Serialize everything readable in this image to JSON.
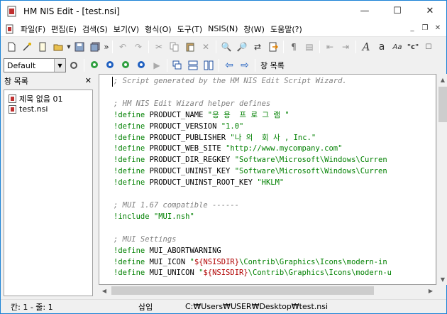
{
  "window": {
    "title": "HM NIS Edit - [test.nsi]",
    "minimize": "—",
    "maximize": "☐",
    "close": "✕"
  },
  "menu": {
    "items": [
      "파일(F)",
      "편집(E)",
      "검색(S)",
      "보기(V)",
      "형식(O)",
      "도구(T)",
      "NSIS(N)",
      "창(W)",
      "도움말(?)"
    ],
    "mdi_minimize": "_",
    "mdi_restore": "❐",
    "mdi_close": "✕"
  },
  "toolbar2": {
    "style_value": "Default",
    "window_list_label": "창 목록"
  },
  "panel": {
    "title": "창 목록",
    "close": "✕",
    "items": [
      "제목 없음 01",
      "test.nsi"
    ]
  },
  "editor": {
    "lines": [
      [
        {
          "c": "cm",
          "t": "; Script generated by the HM NIS Edit Script Wizard."
        }
      ],
      [
        {
          "c": "",
          "t": " "
        }
      ],
      [
        {
          "c": "cm",
          "t": "; HM NIS Edit Wizard helper defines"
        }
      ],
      [
        {
          "c": "kw",
          "t": "!define"
        },
        {
          "c": "",
          "t": " PRODUCT_NAME "
        },
        {
          "c": "st",
          "t": "\"응 용  프 로 그 램 \""
        }
      ],
      [
        {
          "c": "kw",
          "t": "!define"
        },
        {
          "c": "",
          "t": " PRODUCT_VERSION "
        },
        {
          "c": "st",
          "t": "\"1.0\""
        }
      ],
      [
        {
          "c": "kw",
          "t": "!define"
        },
        {
          "c": "",
          "t": " PRODUCT_PUBLISHER "
        },
        {
          "c": "st",
          "t": "\"나 의  회 사 , Inc.\""
        }
      ],
      [
        {
          "c": "kw",
          "t": "!define"
        },
        {
          "c": "",
          "t": " PRODUCT_WEB_SITE "
        },
        {
          "c": "st",
          "t": "\"http://www.mycompany.com\""
        }
      ],
      [
        {
          "c": "kw",
          "t": "!define"
        },
        {
          "c": "",
          "t": " PRODUCT_DIR_REGKEY "
        },
        {
          "c": "st",
          "t": "\"Software\\Microsoft\\Windows\\Curren"
        }
      ],
      [
        {
          "c": "kw",
          "t": "!define"
        },
        {
          "c": "",
          "t": " PRODUCT_UNINST_KEY "
        },
        {
          "c": "st",
          "t": "\"Software\\Microsoft\\Windows\\Curren"
        }
      ],
      [
        {
          "c": "kw",
          "t": "!define"
        },
        {
          "c": "",
          "t": " PRODUCT_UNINST_ROOT_KEY "
        },
        {
          "c": "st",
          "t": "\"HKLM\""
        }
      ],
      [
        {
          "c": "",
          "t": " "
        }
      ],
      [
        {
          "c": "cm",
          "t": "; MUI 1.67 compatible ------"
        }
      ],
      [
        {
          "c": "kw",
          "t": "!include"
        },
        {
          "c": "",
          "t": " "
        },
        {
          "c": "st",
          "t": "\"MUI.nsh\""
        }
      ],
      [
        {
          "c": "",
          "t": " "
        }
      ],
      [
        {
          "c": "cm",
          "t": "; MUI Settings"
        }
      ],
      [
        {
          "c": "kw",
          "t": "!define"
        },
        {
          "c": "",
          "t": " MUI_ABORTWARNING"
        }
      ],
      [
        {
          "c": "kw",
          "t": "!define"
        },
        {
          "c": "",
          "t": " MUI_ICON "
        },
        {
          "c": "st",
          "t": "\""
        },
        {
          "c": "var",
          "t": "${NSISDIR}"
        },
        {
          "c": "st",
          "t": "\\Contrib\\Graphics\\Icons\\modern-in"
        }
      ],
      [
        {
          "c": "kw",
          "t": "!define"
        },
        {
          "c": "",
          "t": " MUI_UNICON "
        },
        {
          "c": "st",
          "t": "\""
        },
        {
          "c": "var",
          "t": "${NSISDIR}"
        },
        {
          "c": "st",
          "t": "\\Contrib\\Graphics\\Icons\\modern-u"
        }
      ]
    ]
  },
  "status": {
    "position": "칸: 1 - 줄: 1",
    "mode": "삽입",
    "path": "C:₩Users₩USER₩Desktop₩test.nsi"
  }
}
